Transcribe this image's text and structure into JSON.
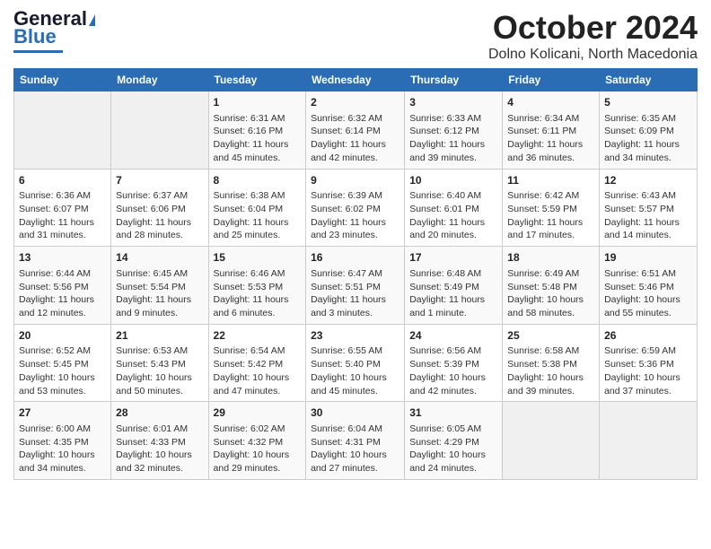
{
  "header": {
    "logo_general": "General",
    "logo_blue": "Blue",
    "month_title": "October 2024",
    "location": "Dolno Kolicani, North Macedonia"
  },
  "days_of_week": [
    "Sunday",
    "Monday",
    "Tuesday",
    "Wednesday",
    "Thursday",
    "Friday",
    "Saturday"
  ],
  "weeks": [
    [
      {
        "day": "",
        "sunrise": "",
        "sunset": "",
        "daylight": ""
      },
      {
        "day": "",
        "sunrise": "",
        "sunset": "",
        "daylight": ""
      },
      {
        "day": "1",
        "sunrise": "Sunrise: 6:31 AM",
        "sunset": "Sunset: 6:16 PM",
        "daylight": "Daylight: 11 hours and 45 minutes."
      },
      {
        "day": "2",
        "sunrise": "Sunrise: 6:32 AM",
        "sunset": "Sunset: 6:14 PM",
        "daylight": "Daylight: 11 hours and 42 minutes."
      },
      {
        "day": "3",
        "sunrise": "Sunrise: 6:33 AM",
        "sunset": "Sunset: 6:12 PM",
        "daylight": "Daylight: 11 hours and 39 minutes."
      },
      {
        "day": "4",
        "sunrise": "Sunrise: 6:34 AM",
        "sunset": "Sunset: 6:11 PM",
        "daylight": "Daylight: 11 hours and 36 minutes."
      },
      {
        "day": "5",
        "sunrise": "Sunrise: 6:35 AM",
        "sunset": "Sunset: 6:09 PM",
        "daylight": "Daylight: 11 hours and 34 minutes."
      }
    ],
    [
      {
        "day": "6",
        "sunrise": "Sunrise: 6:36 AM",
        "sunset": "Sunset: 6:07 PM",
        "daylight": "Daylight: 11 hours and 31 minutes."
      },
      {
        "day": "7",
        "sunrise": "Sunrise: 6:37 AM",
        "sunset": "Sunset: 6:06 PM",
        "daylight": "Daylight: 11 hours and 28 minutes."
      },
      {
        "day": "8",
        "sunrise": "Sunrise: 6:38 AM",
        "sunset": "Sunset: 6:04 PM",
        "daylight": "Daylight: 11 hours and 25 minutes."
      },
      {
        "day": "9",
        "sunrise": "Sunrise: 6:39 AM",
        "sunset": "Sunset: 6:02 PM",
        "daylight": "Daylight: 11 hours and 23 minutes."
      },
      {
        "day": "10",
        "sunrise": "Sunrise: 6:40 AM",
        "sunset": "Sunset: 6:01 PM",
        "daylight": "Daylight: 11 hours and 20 minutes."
      },
      {
        "day": "11",
        "sunrise": "Sunrise: 6:42 AM",
        "sunset": "Sunset: 5:59 PM",
        "daylight": "Daylight: 11 hours and 17 minutes."
      },
      {
        "day": "12",
        "sunrise": "Sunrise: 6:43 AM",
        "sunset": "Sunset: 5:57 PM",
        "daylight": "Daylight: 11 hours and 14 minutes."
      }
    ],
    [
      {
        "day": "13",
        "sunrise": "Sunrise: 6:44 AM",
        "sunset": "Sunset: 5:56 PM",
        "daylight": "Daylight: 11 hours and 12 minutes."
      },
      {
        "day": "14",
        "sunrise": "Sunrise: 6:45 AM",
        "sunset": "Sunset: 5:54 PM",
        "daylight": "Daylight: 11 hours and 9 minutes."
      },
      {
        "day": "15",
        "sunrise": "Sunrise: 6:46 AM",
        "sunset": "Sunset: 5:53 PM",
        "daylight": "Daylight: 11 hours and 6 minutes."
      },
      {
        "day": "16",
        "sunrise": "Sunrise: 6:47 AM",
        "sunset": "Sunset: 5:51 PM",
        "daylight": "Daylight: 11 hours and 3 minutes."
      },
      {
        "day": "17",
        "sunrise": "Sunrise: 6:48 AM",
        "sunset": "Sunset: 5:49 PM",
        "daylight": "Daylight: 11 hours and 1 minute."
      },
      {
        "day": "18",
        "sunrise": "Sunrise: 6:49 AM",
        "sunset": "Sunset: 5:48 PM",
        "daylight": "Daylight: 10 hours and 58 minutes."
      },
      {
        "day": "19",
        "sunrise": "Sunrise: 6:51 AM",
        "sunset": "Sunset: 5:46 PM",
        "daylight": "Daylight: 10 hours and 55 minutes."
      }
    ],
    [
      {
        "day": "20",
        "sunrise": "Sunrise: 6:52 AM",
        "sunset": "Sunset: 5:45 PM",
        "daylight": "Daylight: 10 hours and 53 minutes."
      },
      {
        "day": "21",
        "sunrise": "Sunrise: 6:53 AM",
        "sunset": "Sunset: 5:43 PM",
        "daylight": "Daylight: 10 hours and 50 minutes."
      },
      {
        "day": "22",
        "sunrise": "Sunrise: 6:54 AM",
        "sunset": "Sunset: 5:42 PM",
        "daylight": "Daylight: 10 hours and 47 minutes."
      },
      {
        "day": "23",
        "sunrise": "Sunrise: 6:55 AM",
        "sunset": "Sunset: 5:40 PM",
        "daylight": "Daylight: 10 hours and 45 minutes."
      },
      {
        "day": "24",
        "sunrise": "Sunrise: 6:56 AM",
        "sunset": "Sunset: 5:39 PM",
        "daylight": "Daylight: 10 hours and 42 minutes."
      },
      {
        "day": "25",
        "sunrise": "Sunrise: 6:58 AM",
        "sunset": "Sunset: 5:38 PM",
        "daylight": "Daylight: 10 hours and 39 minutes."
      },
      {
        "day": "26",
        "sunrise": "Sunrise: 6:59 AM",
        "sunset": "Sunset: 5:36 PM",
        "daylight": "Daylight: 10 hours and 37 minutes."
      }
    ],
    [
      {
        "day": "27",
        "sunrise": "Sunrise: 6:00 AM",
        "sunset": "Sunset: 4:35 PM",
        "daylight": "Daylight: 10 hours and 34 minutes."
      },
      {
        "day": "28",
        "sunrise": "Sunrise: 6:01 AM",
        "sunset": "Sunset: 4:33 PM",
        "daylight": "Daylight: 10 hours and 32 minutes."
      },
      {
        "day": "29",
        "sunrise": "Sunrise: 6:02 AM",
        "sunset": "Sunset: 4:32 PM",
        "daylight": "Daylight: 10 hours and 29 minutes."
      },
      {
        "day": "30",
        "sunrise": "Sunrise: 6:04 AM",
        "sunset": "Sunset: 4:31 PM",
        "daylight": "Daylight: 10 hours and 27 minutes."
      },
      {
        "day": "31",
        "sunrise": "Sunrise: 6:05 AM",
        "sunset": "Sunset: 4:29 PM",
        "daylight": "Daylight: 10 hours and 24 minutes."
      },
      {
        "day": "",
        "sunrise": "",
        "sunset": "",
        "daylight": ""
      },
      {
        "day": "",
        "sunrise": "",
        "sunset": "",
        "daylight": ""
      }
    ]
  ]
}
